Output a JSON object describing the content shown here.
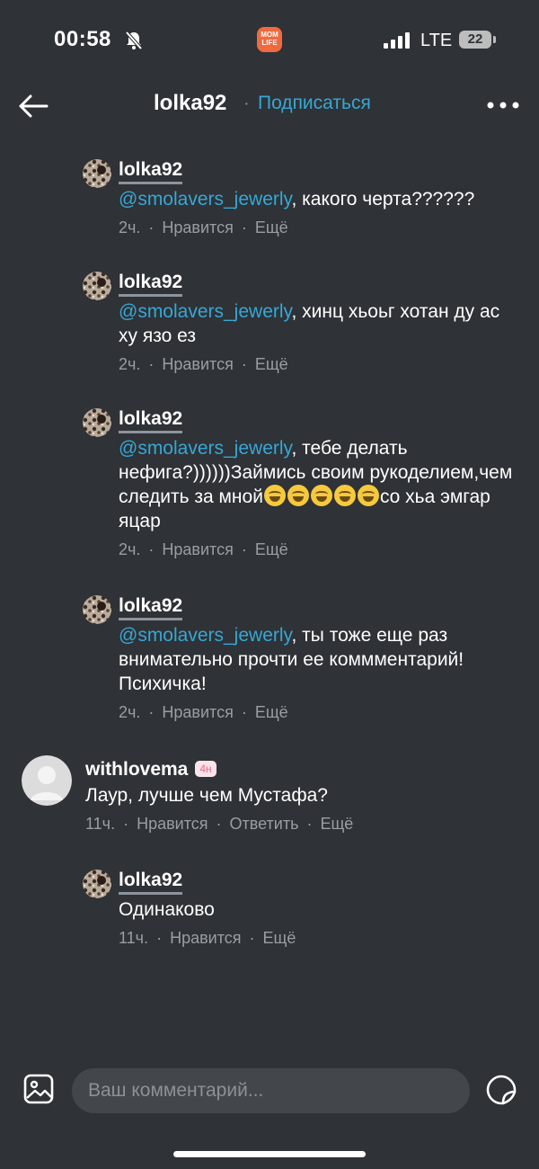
{
  "status_bar": {
    "time": "00:58",
    "app_badge": "MOM LIFE",
    "network": "LTE",
    "battery": "22"
  },
  "header": {
    "username": "lolka92",
    "separator": "·",
    "follow_label": "Подписаться"
  },
  "comments": [
    {
      "author": "lolka92",
      "mention": "@smolavers_jewerly",
      "text": ", какого черта??????",
      "time": "2ч.",
      "like": "Нравится",
      "more": "Ещё"
    },
    {
      "author": "lolka92",
      "mention": "@smolavers_jewerly",
      "text": ", хинц хьоьг хотан ду ас ху язо ез",
      "time": "2ч.",
      "like": "Нравится",
      "more": "Ещё"
    },
    {
      "author": "lolka92",
      "mention": "@smolavers_jewerly",
      "text": ", тебе делать нефига?))))))Займись своим рукоделием,чем следить за мной",
      "text_end": "со хьа эмгар яцар",
      "time": "2ч.",
      "like": "Нравится",
      "more": "Ещё"
    },
    {
      "author": "lolka92",
      "mention": "@smolavers_jewerly",
      "text": ", ты тоже еще раз внимательно прочти ее коммментарий! Психичка!",
      "time": "2ч.",
      "like": "Нравится",
      "more": "Ещё"
    },
    {
      "author": "withlovema",
      "badge": "4н",
      "text": "Лаур, лучше чем Мустафа?",
      "time": "11ч.",
      "like": "Нравится",
      "reply": "Ответить",
      "more": "Ещё"
    },
    {
      "author": "lolka92",
      "text": "Одинаково",
      "time": "11ч.",
      "like": "Нравится",
      "more": "Ещё"
    }
  ],
  "composer": {
    "placeholder": "Ваш комментарий..."
  },
  "colors": {
    "background": "#2f3236",
    "link": "#35a8d6",
    "meta": "#9a9ea3",
    "input_bg": "#43474c"
  },
  "icons": [
    "back-arrow-icon",
    "more-dots-icon",
    "gallery-icon",
    "sticker-icon",
    "silent-bell-icon",
    "signal-icon",
    "battery-icon"
  ]
}
